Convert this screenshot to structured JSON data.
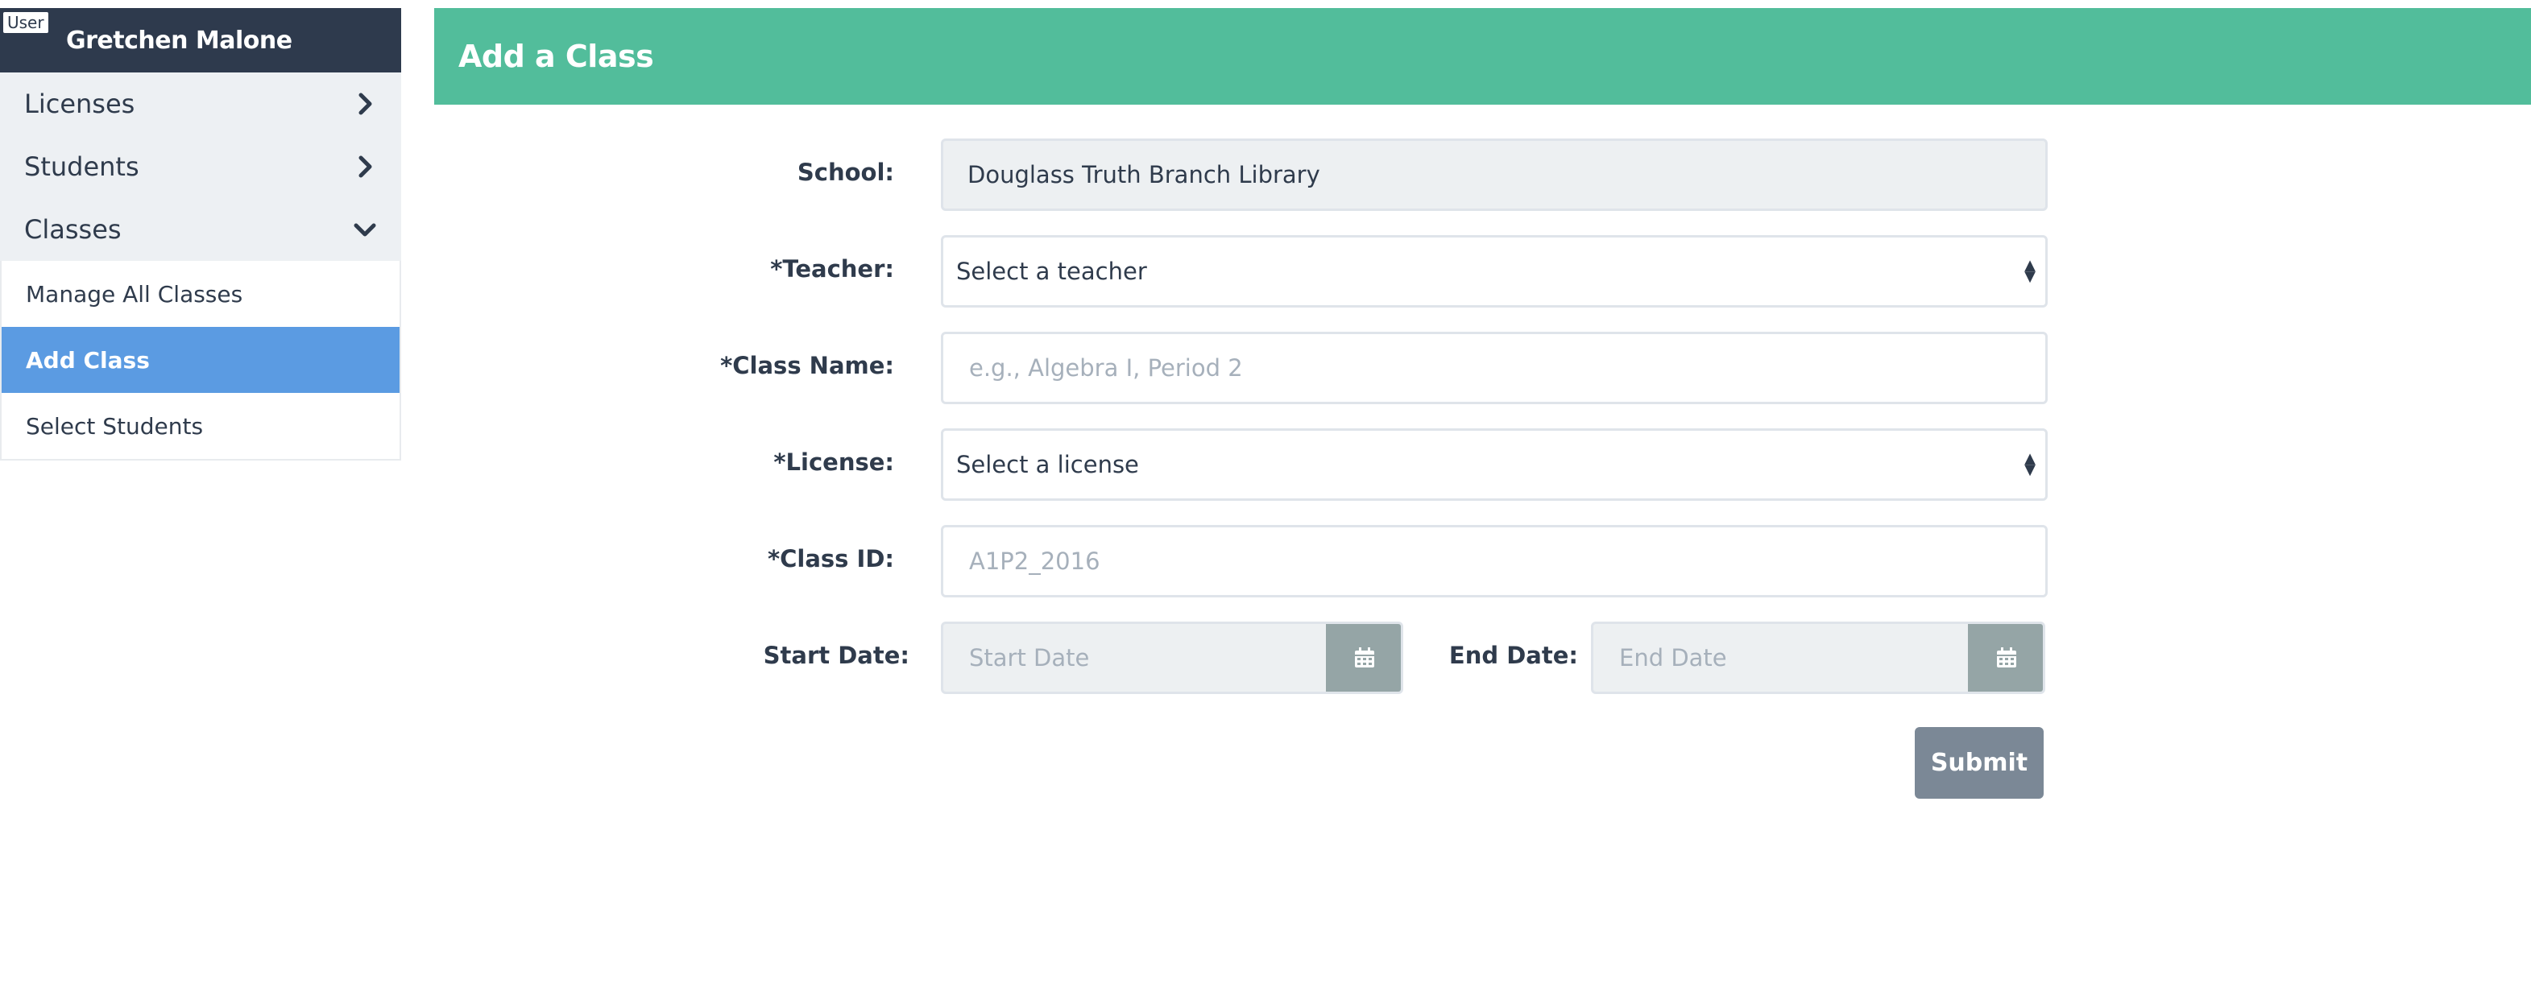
{
  "sidebar": {
    "user_tag": "User",
    "user_name": "Gretchen Malone",
    "items": [
      {
        "label": "Licenses"
      },
      {
        "label": "Students"
      },
      {
        "label": "Classes"
      }
    ],
    "subitems": [
      {
        "label": "Manage All Classes"
      },
      {
        "label": "Add Class"
      },
      {
        "label": "Select Students"
      }
    ],
    "active_subitem": "Add Class"
  },
  "header": {
    "title": "Add a Class"
  },
  "form": {
    "school": {
      "label": "School:",
      "value": "Douglass Truth Branch Library"
    },
    "teacher": {
      "label": "*Teacher:",
      "value": "Select a teacher"
    },
    "class_name": {
      "label": "*Class Name:",
      "placeholder": "e.g., Algebra I, Period 2"
    },
    "license": {
      "label": "*License:",
      "value": "Select a license"
    },
    "class_id": {
      "label": "*Class ID:",
      "placeholder": "A1P2_2016"
    },
    "start_date": {
      "label": "Start Date:",
      "placeholder": "Start Date"
    },
    "end_date": {
      "label": "End Date:",
      "placeholder": "End Date"
    },
    "submit_label": "Submit"
  },
  "colors": {
    "user_bar": "#2e3a4d",
    "header": "#52bd9b",
    "active_nav": "#5b9be2",
    "submit": "#7b8896",
    "calendar_button": "#95a5a6"
  },
  "icons": {
    "nav_collapsed": "chevron-right-icon",
    "nav_expanded": "chevron-down-icon",
    "date_picker": "calendar-icon",
    "select": "select-arrows-icon"
  }
}
